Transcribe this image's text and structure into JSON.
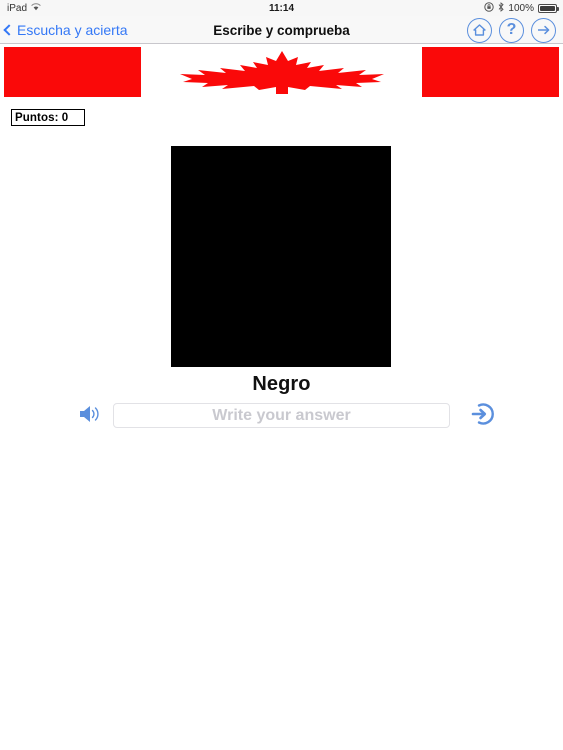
{
  "status_bar": {
    "carrier": "iPad",
    "wifi_icon": "wifi-icon",
    "time": "11:14",
    "rotation_lock_icon": "rotation-lock-icon",
    "bluetooth_icon": "bluetooth-icon",
    "battery_percent": "100%",
    "battery_icon": "battery-full-icon"
  },
  "nav_bar": {
    "back_label": "Escucha y acierta",
    "back_chevron_icon": "chevron-left-icon",
    "title": "Escribe y comprueba",
    "actions": [
      {
        "name": "home-button",
        "icon": "home-icon"
      },
      {
        "name": "help-button",
        "icon": "question-mark-icon",
        "glyph": "?"
      },
      {
        "name": "next-button",
        "icon": "arrow-right-icon"
      }
    ],
    "tint_color": "#3478f6",
    "button_color": "#5b8fdd"
  },
  "flag_banner": {
    "name": "canada-flag-banner",
    "red_color": "#fa0909",
    "white_color": "#ffffff",
    "leaf_icon": "maple-leaf-icon"
  },
  "score": {
    "label": "Puntos: 0"
  },
  "exercise": {
    "color_swatch_name": "color-swatch",
    "color_swatch_hex": "#000000",
    "word": "Negro",
    "speaker_icon": "speaker-icon",
    "submit_icon": "arrow-into-circle-icon",
    "input_value": "",
    "input_placeholder": "Write your answer",
    "placeholder_color": "#c9c9cf",
    "accent_color": "#5b8fdd"
  }
}
